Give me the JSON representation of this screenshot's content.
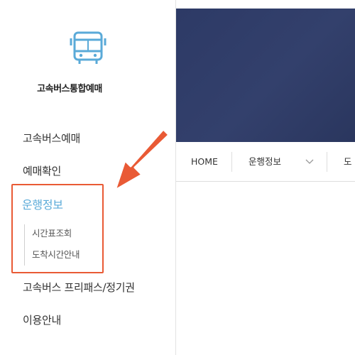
{
  "logo": {
    "text": "고속버스통합예매",
    "icon": "bus-icon"
  },
  "sidebar": {
    "menu": [
      {
        "label": "고속버스예매"
      },
      {
        "label": "예매확인"
      },
      {
        "label": "운행정보",
        "active": true,
        "submenu": [
          {
            "label": "시간표조회"
          },
          {
            "label": "도착시간안내"
          }
        ]
      },
      {
        "label": "고속버스 프리패스/정기권"
      },
      {
        "label": "이용안내"
      }
    ]
  },
  "nav": {
    "home": "HOME",
    "current": "운행정보",
    "next_partial": "도"
  },
  "colors": {
    "accent": "#5aaad8",
    "highlight": "#e95a35",
    "hero": "#2d3a66"
  }
}
